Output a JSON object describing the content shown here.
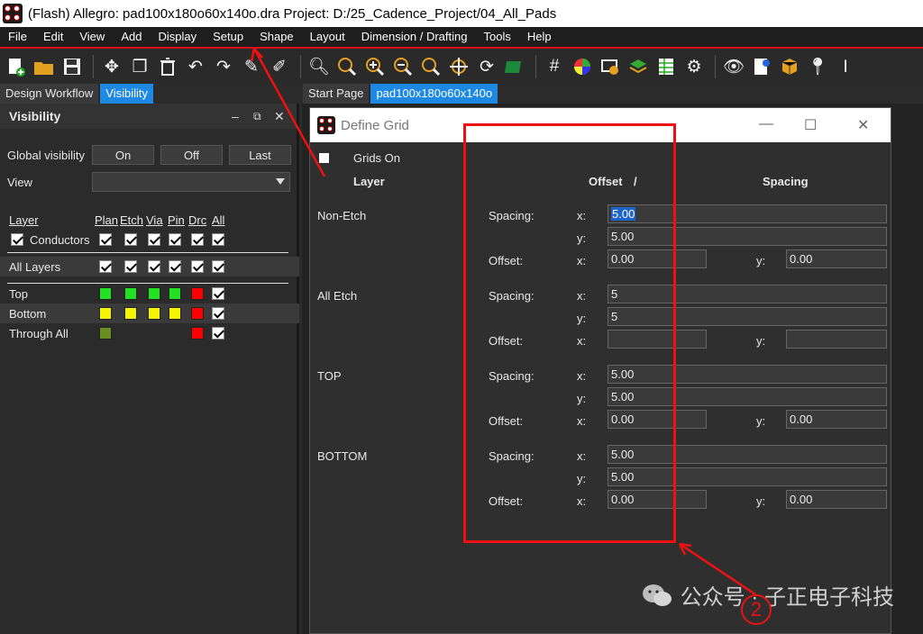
{
  "window": {
    "title": "(Flash) Allegro: pad100x180o60x140o.dra  Project: D:/25_Cadence_Project/04_All_Pads"
  },
  "menu": [
    "File",
    "Edit",
    "View",
    "Add",
    "Display",
    "Setup",
    "Shape",
    "Layout",
    "Dimension / Drafting",
    "Tools",
    "Help"
  ],
  "toolbar_icons": [
    "new-file-icon",
    "open-folder-icon",
    "save-icon",
    "move-icon",
    "copy-icon",
    "delete-icon",
    "undo-icon",
    "redo-icon",
    "pin-icon",
    "unpin-icon",
    "zoom-fit-icon",
    "zoom-icon",
    "zoom-in-icon",
    "zoom-out-icon",
    "zoom-previous-icon",
    "zoom-center-icon",
    "refresh-icon",
    "3d-view-icon",
    "grid-icon",
    "color-icon",
    "layer-icon",
    "stack-icon",
    "spreadsheet-icon",
    "settings-icon",
    "visibility-icon",
    "report-icon",
    "package-icon",
    "marker-icon",
    "text-cursor-icon"
  ],
  "left_tabs": [
    "Design Workflow",
    "Visibility"
  ],
  "right_tabs": [
    "Start Page",
    "pad100x180o60x140o"
  ],
  "visibility": {
    "title": "Visibility",
    "global_label": "Global visibility",
    "buttons": [
      "On",
      "Off",
      "Last"
    ],
    "view_label": "View",
    "view_value": "",
    "columns": [
      "Layer",
      "Plan",
      "Etch",
      "Via",
      "Pin",
      "Drc",
      "All"
    ],
    "conductors_label": "Conductors",
    "all_layers_label": "All Layers",
    "layers": [
      {
        "name": "Top",
        "color": "#22e022"
      },
      {
        "name": "Bottom",
        "color": "#f5f500"
      },
      {
        "name": "Through All",
        "color": "#6b8e23"
      }
    ],
    "drc_color": "#ff0000"
  },
  "dialog": {
    "title": "Define Grid",
    "grids_on_label": "Grids On",
    "col_layer": "Layer",
    "col_offset": "Offset",
    "col_slash": "/",
    "col_spacing": "Spacing",
    "spacing_label": "Spacing:",
    "offset_label": "Offset:",
    "x_label": "x:",
    "y_label": "y:",
    "sections": [
      {
        "name": "Non-Etch",
        "sx": "5.00",
        "sy": "5.00",
        "ox": "0.00",
        "oy": "0.00"
      },
      {
        "name": "All Etch",
        "sx": "5",
        "sy": "5",
        "ox": "",
        "oy": ""
      },
      {
        "name": "TOP",
        "sx": "5.00",
        "sy": "5.00",
        "ox": "0.00",
        "oy": "0.00"
      },
      {
        "name": "BOTTOM",
        "sx": "5.00",
        "sy": "5.00",
        "ox": "0.00",
        "oy": "0.00"
      }
    ]
  },
  "annotation": {
    "marker": "2",
    "color": "#ee1111"
  },
  "watermark": "公众号 · 子正电子科技"
}
